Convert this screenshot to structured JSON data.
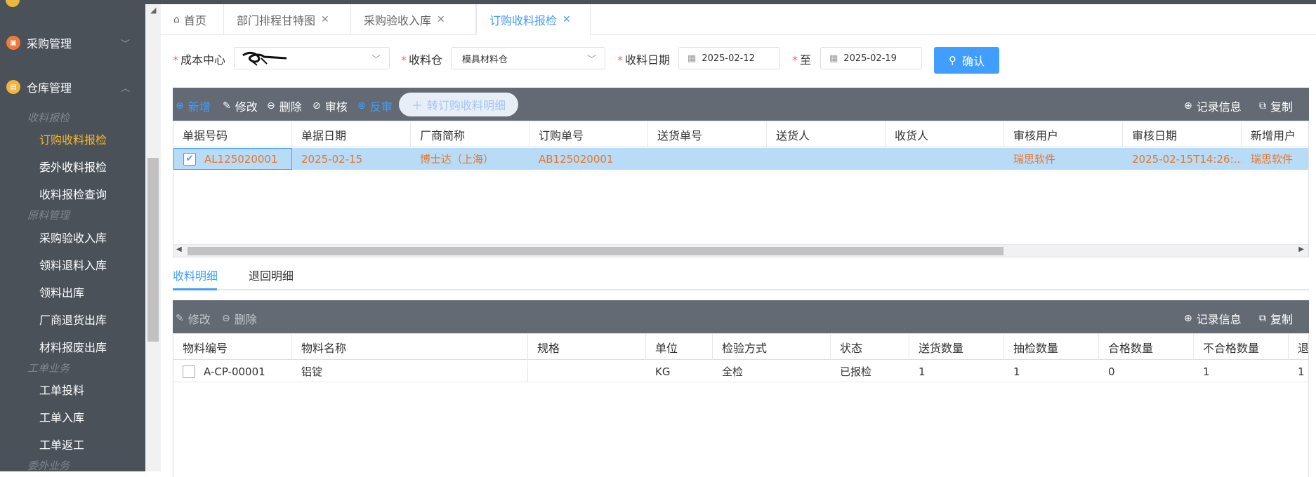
{
  "sidebar": {
    "groups": [
      {
        "label": "采购管理",
        "icon": "purchase-icon",
        "color": "#f07a3c",
        "arrow": "﹀"
      },
      {
        "label": "仓库管理",
        "icon": "warehouse-icon",
        "color": "#f2b43a",
        "arrow": "︿"
      }
    ],
    "sections": [
      "收料报检",
      "原料管理",
      "工单业务",
      "委外业务"
    ],
    "items": [
      "订购收料报检",
      "委外收料报检",
      "收料报检查询",
      "采购验收入库",
      "领料退料入库",
      "领料出库",
      "厂商退货出库",
      "材料报废出库",
      "工单投料",
      "工单入库",
      "工单返工"
    ],
    "active_item": "订购收料报检"
  },
  "tabs": [
    {
      "label": "首页",
      "closable": false
    },
    {
      "label": "部门排程甘特图",
      "closable": true
    },
    {
      "label": "采购验收入库",
      "closable": true
    },
    {
      "label": "订购收料报检",
      "closable": true,
      "active": true
    }
  ],
  "filters": {
    "cost_center_label": "成本中心",
    "cost_center_value": "",
    "warehouse_label": "收料仓",
    "warehouse_value": "模具材料仓",
    "date_label": "收料日期",
    "date_from": "2025-02-12",
    "to_label": "至",
    "date_to": "2025-02-19",
    "confirm_label": "确认"
  },
  "master_toolbar": {
    "add": "新增",
    "edit": "修改",
    "delete": "删除",
    "approve": "审核",
    "unapprove": "反审",
    "convert": "转订购收料明细",
    "record_info": "记录信息",
    "copy": "复制"
  },
  "master_grid": {
    "columns": [
      "单据号码",
      "单据日期",
      "厂商简称",
      "订购单号",
      "送货单号",
      "送货人",
      "收货人",
      "审核用户",
      "审核日期",
      "新增用户"
    ],
    "rows": [
      {
        "checked": true,
        "doc_no": "AL125020001",
        "doc_date": "2025-02-15",
        "vendor": "博士达（上海）",
        "po_no": "AB125020001",
        "delivery_no": "",
        "deliverer": "",
        "receiver": "",
        "approver": "瑞思软件",
        "approve_date": "2025-02-15T14:26:...",
        "creator": "瑞思软件"
      }
    ]
  },
  "sub_tabs": [
    "收料明细",
    "退回明细"
  ],
  "detail_toolbar": {
    "edit": "修改",
    "delete": "删除",
    "record_info": "记录信息",
    "copy": "复制"
  },
  "detail_grid": {
    "columns": [
      "物料编号",
      "物料名称",
      "规格",
      "单位",
      "检验方式",
      "状态",
      "送货数量",
      "抽检数量",
      "合格数量",
      "不合格数量",
      "退"
    ],
    "rows": [
      {
        "checked": false,
        "code": "A-CP-00001",
        "name": "铝锭",
        "spec": "",
        "unit": "KG",
        "method": "全检",
        "status": "已报检",
        "delivered": "1",
        "sampled": "1",
        "qualified": "0",
        "unqualified": "1",
        "returned": "1"
      }
    ]
  },
  "colors": {
    "accent": "#409eff",
    "sidebar_bg": "#4a5159",
    "active_menu": "#f7b52c",
    "selected_row_text": "#e8742a"
  }
}
